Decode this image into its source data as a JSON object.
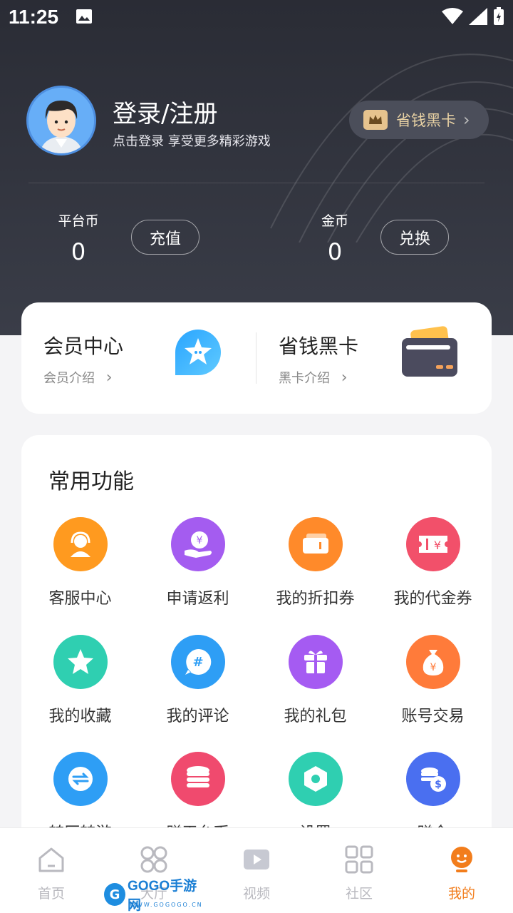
{
  "status_bar": {
    "time": "11:25"
  },
  "profile": {
    "title": "登录/注册",
    "subtitle": "点击登录 享受更多精彩游戏",
    "vip_pill_label": "省钱黑卡",
    "vip_pill_chevron": "›"
  },
  "wallet": {
    "platform_coin_label": "平台币",
    "platform_coin_value": "0",
    "recharge_button": "充值",
    "gold_label": "金币",
    "gold_value": "0",
    "exchange_button": "兑换"
  },
  "member": {
    "center_title": "会员中心",
    "center_sub": "会员介绍",
    "card_title": "省钱黑卡",
    "card_sub": "黑卡介绍",
    "chevron": "›"
  },
  "functions": {
    "title": "常用功能",
    "items": [
      {
        "label": "客服中心",
        "color": "#ff9a1f",
        "icon": "headset-icon"
      },
      {
        "label": "申请返利",
        "color": "#a45cf0",
        "icon": "rebate-icon"
      },
      {
        "label": "我的折扣券",
        "color": "#ff8a2a",
        "icon": "discount-coupon-icon"
      },
      {
        "label": "我的代金券",
        "color": "#f2506a",
        "icon": "voucher-icon"
      },
      {
        "label": "我的收藏",
        "color": "#2fcfb1",
        "icon": "star-icon"
      },
      {
        "label": "我的评论",
        "color": "#2e9ef5",
        "icon": "comment-icon"
      },
      {
        "label": "我的礼包",
        "color": "#a55bf2",
        "icon": "gift-icon"
      },
      {
        "label": "账号交易",
        "color": "#ff7b3a",
        "icon": "money-bag-icon"
      },
      {
        "label": "转区转游",
        "color": "#2e9ef5",
        "icon": "transfer-icon"
      },
      {
        "label": "赚平台币",
        "color": "#f04a6e",
        "icon": "coins-stack-icon"
      },
      {
        "label": "设置",
        "color": "#2fcfb1",
        "icon": "settings-hex-icon"
      },
      {
        "label": "赚金",
        "color": "#4a6ff0",
        "icon": "gold-earn-icon"
      }
    ]
  },
  "bottom_nav": {
    "items": [
      {
        "label": "首页",
        "icon": "home-icon"
      },
      {
        "label": "大厅",
        "icon": "hall-icon"
      },
      {
        "label": "视频",
        "icon": "video-icon"
      },
      {
        "label": "社区",
        "icon": "community-icon"
      },
      {
        "label": "我的",
        "icon": "mine-icon"
      }
    ],
    "active_color": "#f27d1c"
  },
  "watermark": {
    "logo_letter": "G",
    "brand": "GOGO手游网",
    "url": "WWW.GOGOGO.CN"
  }
}
